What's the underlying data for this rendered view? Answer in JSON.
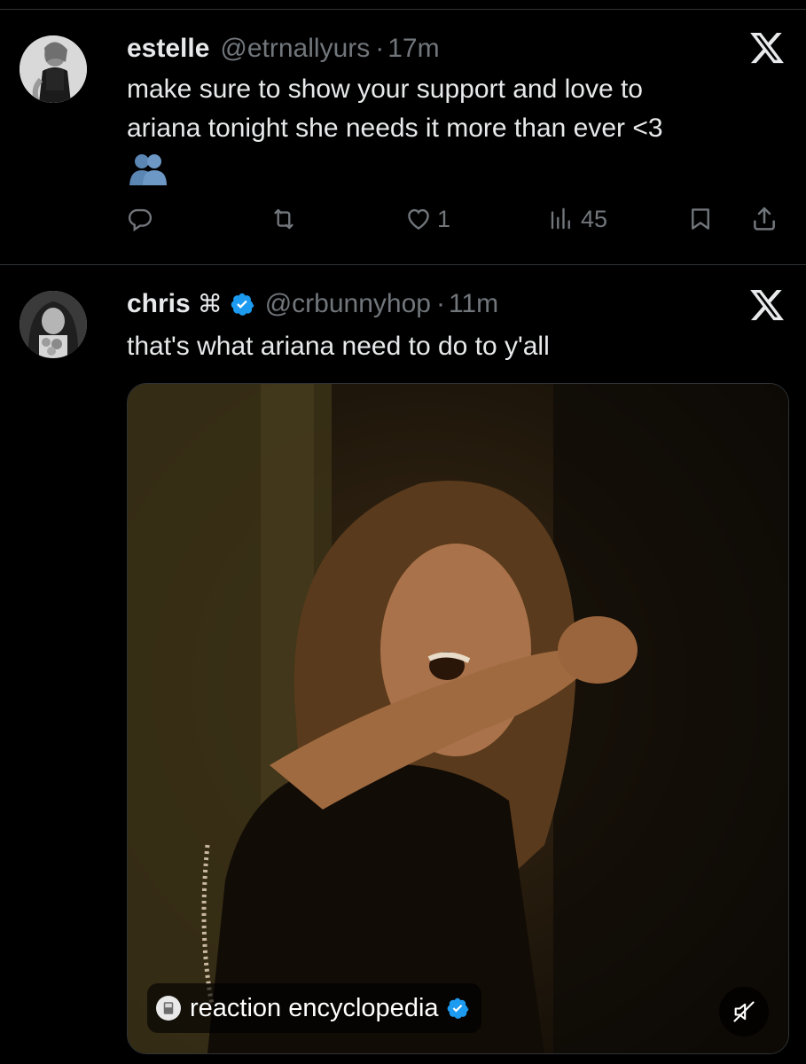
{
  "tweets": [
    {
      "name": "estelle",
      "handle": "@etrnallyurs",
      "separator": "·",
      "time": "17m",
      "text_lines": [
        "make sure to show your support and love to",
        "ariana tonight she needs it more than ever <3"
      ],
      "emoji_icon": "busts-in-silhouette-icon",
      "actions": {
        "reply_count": "",
        "retweet_count": "",
        "like_count": "1",
        "view_count": "45"
      }
    },
    {
      "name": "chris",
      "name_symbol": "⌘",
      "verified": true,
      "handle": "@crbunnyhop",
      "separator": "·",
      "time": "11m",
      "text_lines": [
        "that's what ariana need to do to y'all"
      ],
      "media": {
        "type": "video",
        "source_label": "reaction encyclopedia",
        "source_verified": true,
        "muted": true
      }
    }
  ],
  "colors": {
    "background": "#000000",
    "text_primary": "#e7e9ea",
    "text_secondary": "#71767b",
    "verified_blue": "#1d9bf0",
    "divider": "#2f3336"
  }
}
